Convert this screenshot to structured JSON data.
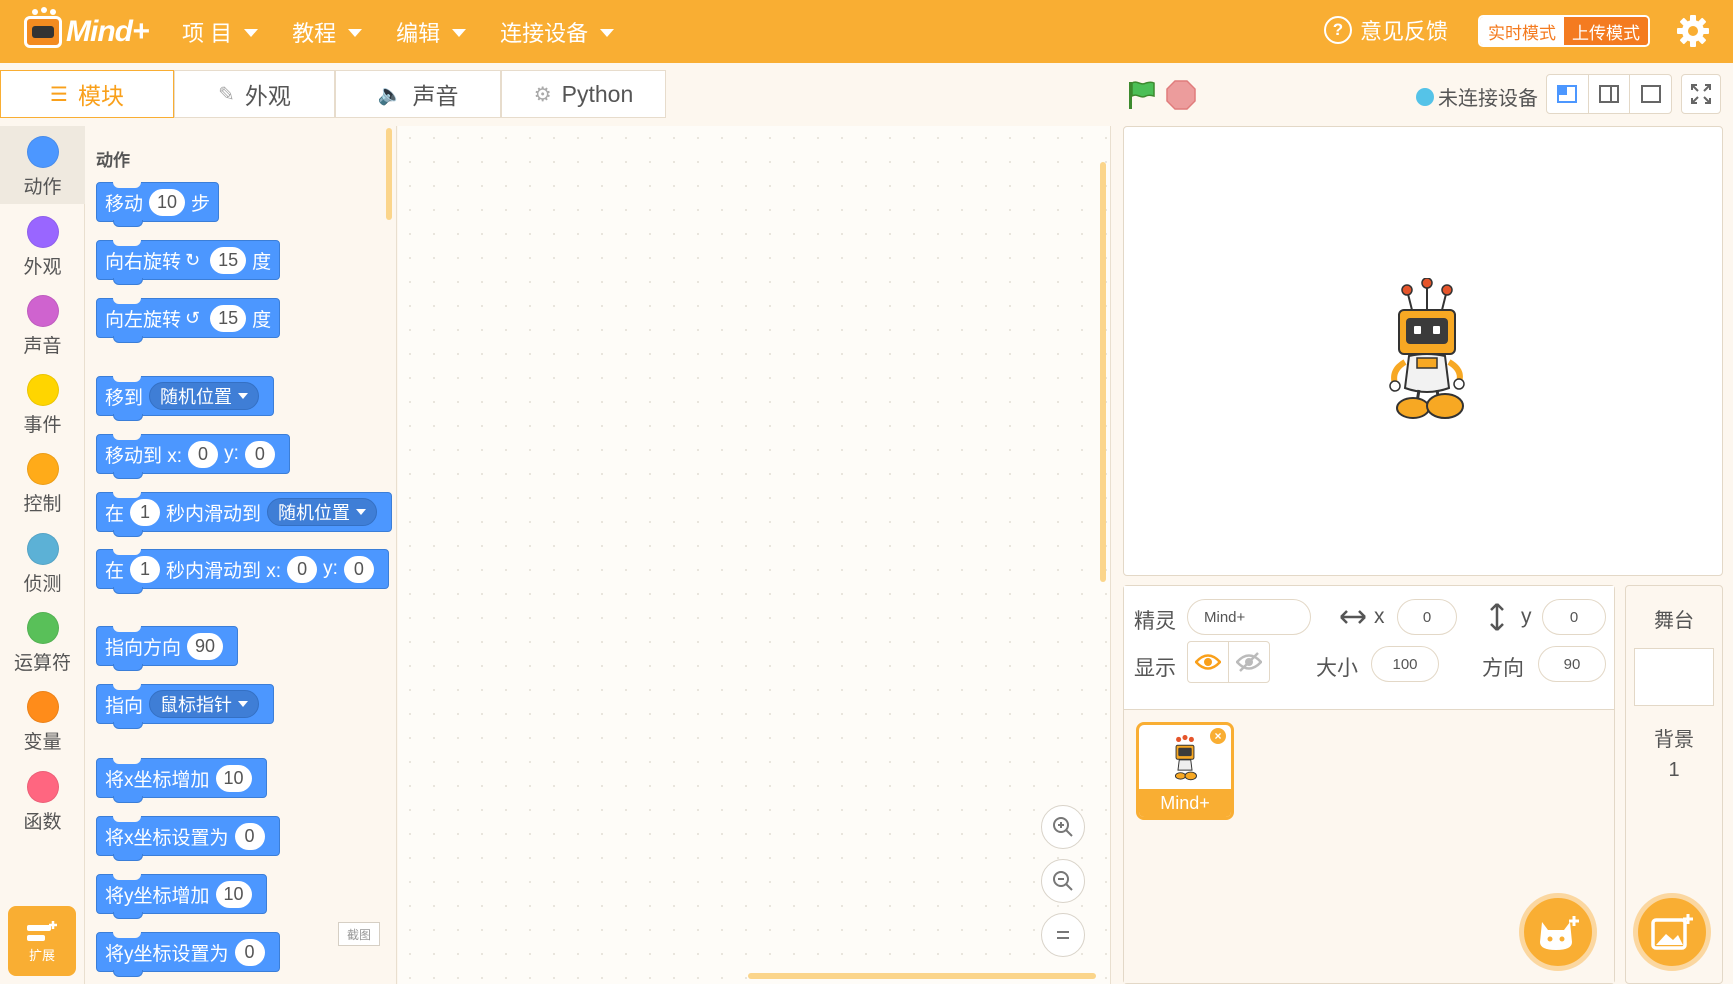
{
  "app": {
    "logo_text": "Mind+"
  },
  "menu": [
    {
      "label": "项 目"
    },
    {
      "label": "教程"
    },
    {
      "label": "编辑"
    },
    {
      "label": "连接设备"
    }
  ],
  "header": {
    "feedback": "意见反馈",
    "modes": {
      "live": "实时模式",
      "upload": "上传模式"
    }
  },
  "tabs": [
    {
      "label": "模块",
      "icon": "blocks-icon"
    },
    {
      "label": "外观",
      "icon": "brush-icon"
    },
    {
      "label": "声音",
      "icon": "speaker-icon"
    },
    {
      "label": "Python",
      "icon": "python-icon"
    }
  ],
  "device_status": "未连接设备",
  "categories": [
    {
      "label": "动作",
      "color": "#4c97ff"
    },
    {
      "label": "外观",
      "color": "#9966ff"
    },
    {
      "label": "声音",
      "color": "#cf63cf"
    },
    {
      "label": "事件",
      "color": "#ffd500"
    },
    {
      "label": "控制",
      "color": "#ffab19"
    },
    {
      "label": "侦测",
      "color": "#5cb1d6"
    },
    {
      "label": "运算符",
      "color": "#59c059"
    },
    {
      "label": "变量",
      "color": "#ff8c1a"
    },
    {
      "label": "函数",
      "color": "#ff6680"
    }
  ],
  "extension": {
    "label": "扩展"
  },
  "palette": {
    "section_title": "动作",
    "blocks": {
      "move": {
        "a": "移动",
        "v": "10",
        "b": "步"
      },
      "turn_right": {
        "a": "向右旋转",
        "v": "15",
        "b": "度"
      },
      "turn_left": {
        "a": "向左旋转",
        "v": "15",
        "b": "度"
      },
      "goto": {
        "a": "移到",
        "dd": "随机位置"
      },
      "goto_xy": {
        "a": "移动到 x:",
        "x": "0",
        "y_label": "y:",
        "y": "0"
      },
      "glide": {
        "a": "在",
        "v": "1",
        "b": "秒内滑动到",
        "dd": "随机位置"
      },
      "glide_xy": {
        "a": "在",
        "v": "1",
        "b": "秒内滑动到 x:",
        "x": "0",
        "y_label": "y:",
        "y": "0"
      },
      "point_dir": {
        "a": "指向方向",
        "v": "90"
      },
      "point_to": {
        "a": "指向",
        "dd": "鼠标指针"
      },
      "change_x": {
        "a": "将x坐标增加",
        "v": "10"
      },
      "set_x": {
        "a": "将x坐标设置为",
        "v": "0"
      },
      "change_y": {
        "a": "将y坐标增加",
        "v": "10"
      },
      "set_y": {
        "a": "将y坐标设置为",
        "v": "0"
      }
    },
    "screenshot_label": "截图"
  },
  "sprite_info": {
    "sprite_label": "精灵",
    "sprite_name": "Mind+",
    "x_label": "x",
    "x": "0",
    "y_label": "y",
    "y": "0",
    "show_label": "显示",
    "size_label": "大小",
    "size": "100",
    "direction_label": "方向",
    "direction": "90"
  },
  "sprites": [
    {
      "name": "Mind+"
    }
  ],
  "stage_panel": {
    "title": "舞台",
    "backdrop_label": "背景",
    "backdrop_count": "1"
  },
  "colors": {
    "accent": "#f9ae33",
    "block_motion": "#4c97ff",
    "mode_active_text": "#f47b20"
  }
}
